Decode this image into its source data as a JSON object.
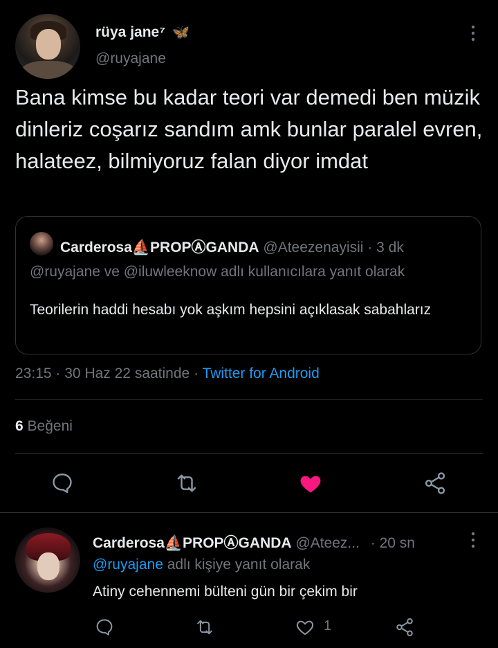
{
  "tweet": {
    "author_name": "rüya jane⁷",
    "author_emoji": "🦋",
    "author_handle": "@ruyajane",
    "text": "Bana kimse bu kadar teori var demedi ben müzik dinleriz coşarız sandım amk bunlar paralel evren, halateez, bilmiyoruz falan diyor imdat",
    "time": "23:15",
    "date": "30 Haz 22 saatinde",
    "client": "Twitter for Android",
    "likes_count": "6",
    "likes_label": "Beğeni",
    "liked": true,
    "colors": {
      "like": "#f91880",
      "link": "#1d9bf0",
      "muted": "#71767b"
    }
  },
  "quote": {
    "author_name": "Carderosa⛵PROPⒶGANDA",
    "author_handle": "@Ateezenayisii",
    "age": "3 dk",
    "reply_to": "@ruyajane ve @iluwleeknow adlı kullanıcılara yanıt olarak",
    "text": "Teorilerin haddi hesabı yok aşkım hepsini açıklasak sabahlarız"
  },
  "reply": {
    "author_name": "Carderosa⛵PROPⒶGANDA",
    "author_handle": "@Ateez...",
    "age": "20 sn",
    "reply_to_user": "@ruyajane",
    "reply_to_suffix": "adlı kişiye yanıt olarak",
    "text": "Atiny cehennemi bülteni gün bir çekim bir",
    "like_count": "1"
  },
  "icons": [
    "more-vertical-icon",
    "reply-icon",
    "retweet-icon",
    "like-icon",
    "share-icon"
  ]
}
